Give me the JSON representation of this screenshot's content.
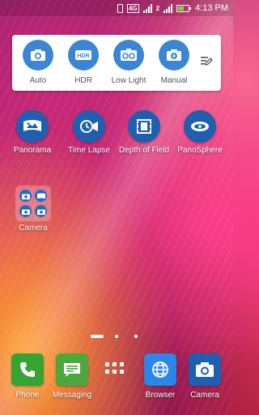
{
  "status_bar": {
    "network": "4G",
    "sim": "2",
    "time": "4:13 PM",
    "battery_level": 0.6
  },
  "camera_widget": {
    "modes": [
      {
        "label": "Auto",
        "icon": "camera-icon"
      },
      {
        "label": "HDR",
        "icon": "hdr-icon"
      },
      {
        "label": "Low Light",
        "icon": "low-light-icon"
      },
      {
        "label": "Manual",
        "icon": "manual-camera-icon"
      }
    ],
    "hdr_badge": "HDR",
    "edit_icon": "edit-icon"
  },
  "home_apps": [
    {
      "label": "Panorama",
      "icon": "panorama-icon"
    },
    {
      "label": "Time Lapse",
      "icon": "time-lapse-icon"
    },
    {
      "label": "Depth of Field",
      "icon": "depth-of-field-icon"
    },
    {
      "label": "PanoSphere",
      "icon": "panosphere-icon"
    }
  ],
  "folder": {
    "label": "Camera"
  },
  "dock": {
    "phone": "Phone",
    "messaging": "Messaging",
    "browser": "Browser",
    "camera": "Camera"
  },
  "colors": {
    "accent": "#3a86d4",
    "phone": "#35a433",
    "messaging": "#4aa93a",
    "browser": "#2a86e8",
    "camera": "#1f5fb0"
  }
}
